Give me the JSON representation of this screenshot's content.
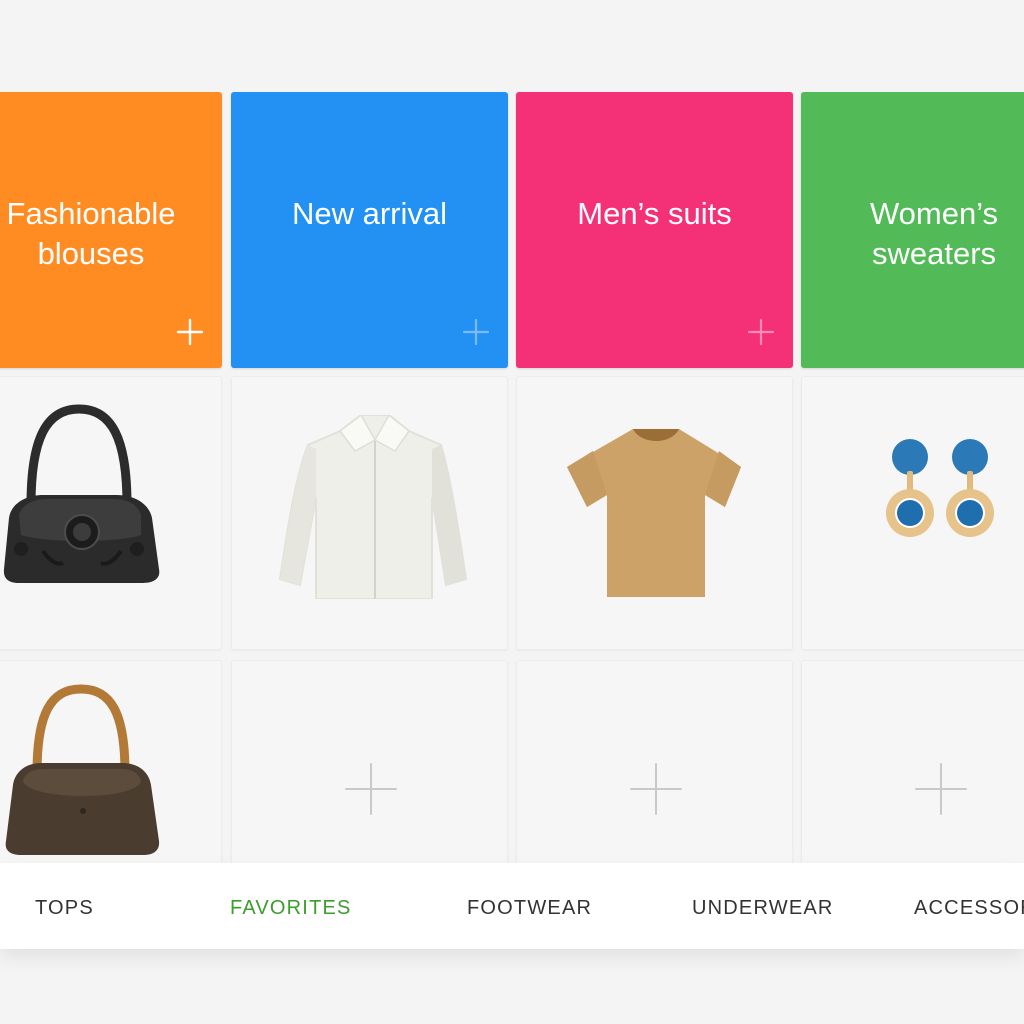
{
  "categories": [
    {
      "title": "Fashionable\nblouses",
      "color": "#ff8c22",
      "plus_color": "#ffffff"
    },
    {
      "title": "New arrival",
      "color": "#2390f3",
      "plus_color": "#7bbcf7"
    },
    {
      "title": "Men’s suits",
      "color": "#f43176",
      "plus_color": "#ff8eb6"
    },
    {
      "title": "Women’s\nsweaters",
      "color": "#52bb58",
      "plus_color": "#ffffff"
    }
  ],
  "items": {
    "row1": [
      "black-handbag-icon",
      "white-shirt-icon",
      "tan-tshirt-icon",
      "blue-earrings-icon"
    ],
    "row2": [
      "brown-handbag-icon",
      "add-icon",
      "add-icon",
      "add-icon"
    ]
  },
  "tabs": [
    {
      "label": "TOPS",
      "active": false
    },
    {
      "label": "FAVORITES",
      "active": true
    },
    {
      "label": "FOOTWEAR",
      "active": false
    },
    {
      "label": "UNDERWEAR",
      "active": false
    },
    {
      "label": "ACCESSORIES",
      "active": false
    }
  ],
  "colors": {
    "active_tab": "#3a9d2c",
    "tab_text": "#333333",
    "background": "#f4f4f4"
  }
}
